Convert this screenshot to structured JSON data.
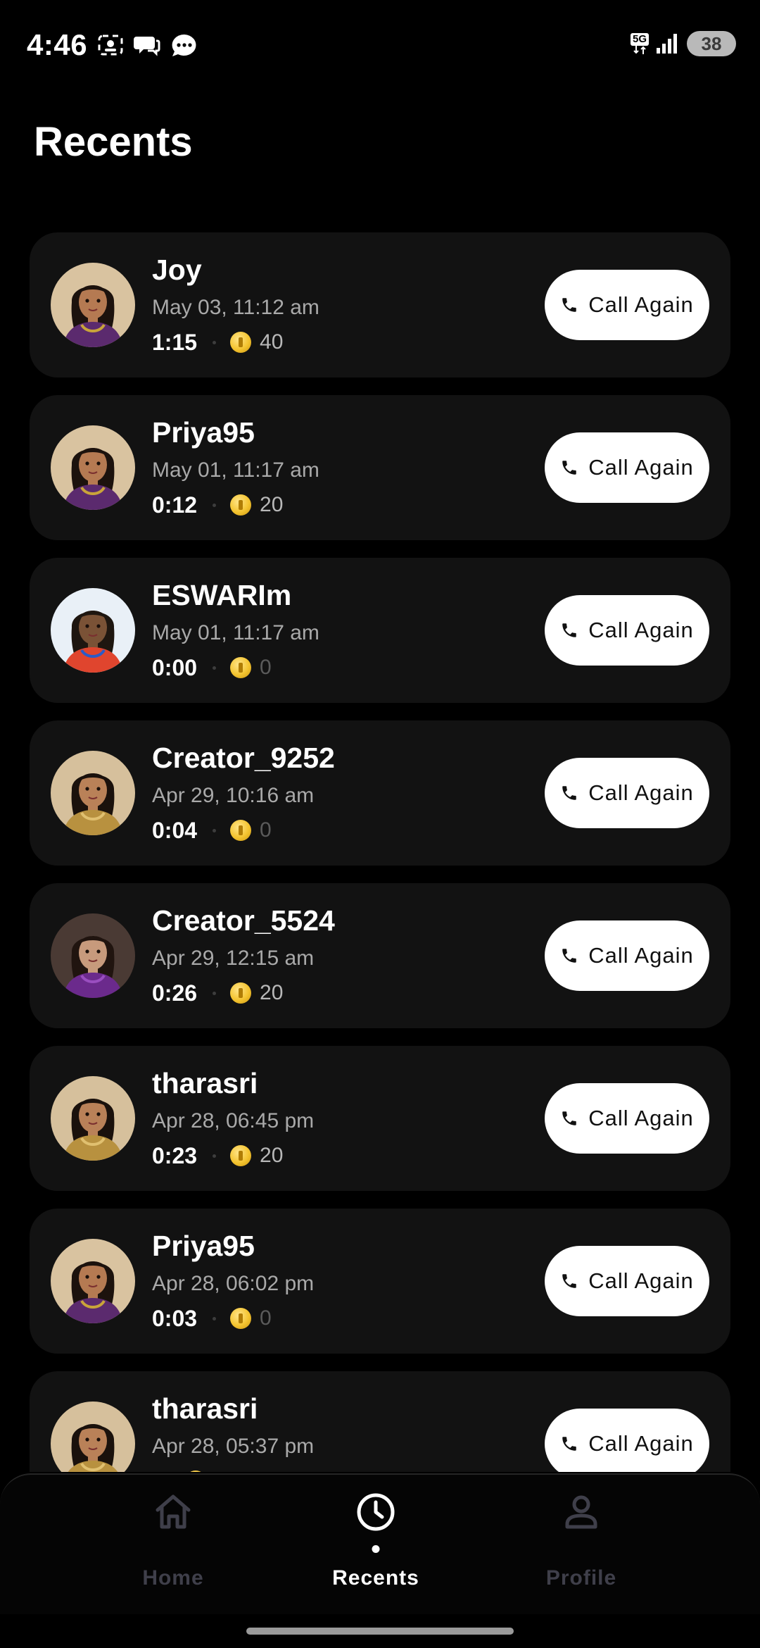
{
  "status_bar": {
    "time": "4:46",
    "network": "5G",
    "battery": "38",
    "left_icons": [
      "screenshot-icon",
      "chat-bubbles-icon",
      "message-icon"
    ],
    "right_icons": [
      "5g-icon",
      "signal-icon",
      "battery-icon"
    ]
  },
  "page": {
    "title": "Recents"
  },
  "call_again_label": "Call Again",
  "calls": [
    {
      "name": "Joy",
      "date": "May 03, 11:12 am",
      "duration": "1:15",
      "coins": "40",
      "avatar": "cartoon-purple-saree"
    },
    {
      "name": "Priya95",
      "date": "May 01, 11:17 am",
      "duration": "0:12",
      "coins": "20",
      "avatar": "cartoon-purple-saree"
    },
    {
      "name": "ESWARIm",
      "date": "May 01, 11:17 am",
      "duration": "0:00",
      "coins": "0",
      "avatar": "photo-blue-background"
    },
    {
      "name": "Creator_9252",
      "date": "Apr 29, 10:16 am",
      "duration": "0:04",
      "coins": "0",
      "avatar": "cartoon-gold-dress"
    },
    {
      "name": "Creator_5524",
      "date": "Apr 29, 12:15 am",
      "duration": "0:26",
      "coins": "20",
      "avatar": "photo-purple-saree"
    },
    {
      "name": "tharasri",
      "date": "Apr 28, 06:45 pm",
      "duration": "0:23",
      "coins": "20",
      "avatar": "cartoon-gold-dress"
    },
    {
      "name": "Priya95",
      "date": "Apr 28, 06:02 pm",
      "duration": "0:03",
      "coins": "0",
      "avatar": "cartoon-purple-saree"
    },
    {
      "name": "tharasri",
      "date": "Apr 28, 05:37 pm",
      "duration": "",
      "coins": "",
      "avatar": "cartoon-gold-dress"
    }
  ],
  "bottom_nav": {
    "items": [
      {
        "label": "Home",
        "icon": "home-icon",
        "active": false
      },
      {
        "label": "Recents",
        "icon": "clock-icon",
        "active": true
      },
      {
        "label": "Profile",
        "icon": "person-icon",
        "active": false
      }
    ]
  },
  "colors": {
    "background": "#000000",
    "card": "#121212",
    "button": "#ffffff",
    "secondary_text": "#a9a9a9",
    "inactive_nav": "#3f3f4a",
    "coin": "#f4c430"
  }
}
